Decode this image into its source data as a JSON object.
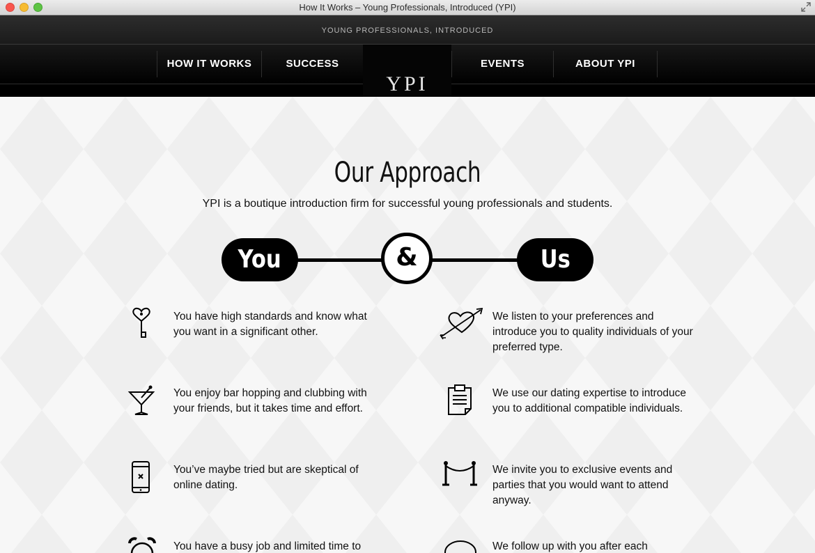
{
  "window": {
    "title": "How It Works – Young Professionals, Introduced (YPI)"
  },
  "site": {
    "tagline": "YOUNG PROFESSIONALS, INTRODUCED",
    "logo": "YPI"
  },
  "nav": {
    "items": [
      {
        "label": "HOW IT WORKS"
      },
      {
        "label": "SUCCESS"
      },
      {
        "label": "EVENTS"
      },
      {
        "label": "ABOUT YPI"
      }
    ]
  },
  "main": {
    "title": "Our Approach",
    "subtitle": "YPI is a boutique introduction firm for successful young professionals and students.",
    "you_label": "You",
    "amp_label": "&",
    "us_label": "Us"
  },
  "you_items": [
    {
      "icon": "heart-key-icon",
      "text": "You have high standards and know what you want in a significant other."
    },
    {
      "icon": "martini-glass-icon",
      "text": "You enjoy bar hopping and clubbing with your friends, but it takes time and effort."
    },
    {
      "icon": "phone-x-icon",
      "text": "You’ve maybe tried but are skeptical of online dating."
    },
    {
      "icon": "alarm-clock-icon",
      "text": "You have a busy job and limited time to"
    }
  ],
  "us_items": [
    {
      "icon": "heart-arrow-icon",
      "text": "We listen to your preferences and introduce you to quality individuals of your preferred type."
    },
    {
      "icon": "clipboard-icon",
      "text": "We use our dating expertise to introduce you to additional compatible individuals."
    },
    {
      "icon": "velvet-rope-icon",
      "text": "We invite you to exclusive events and parties that you would want to attend anyway."
    },
    {
      "icon": "speech-bubble-icon",
      "text": "We follow up with you after each"
    }
  ]
}
